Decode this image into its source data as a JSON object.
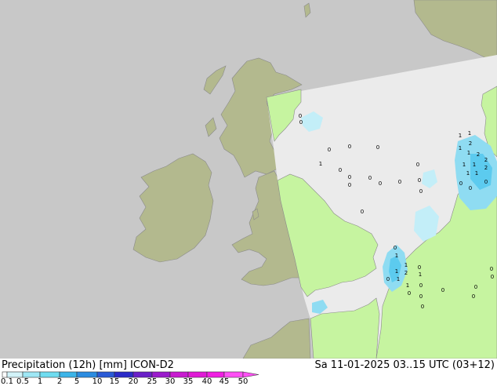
{
  "header": {
    "title": "Precipitation (12h) [mm] ICON-D2",
    "valid_time": "Sa 11-01-2025 03..15 UTC (03+12)"
  },
  "legend": {
    "ticks": [
      "0.1",
      "0.5",
      "1",
      "2",
      "5",
      "10",
      "15",
      "20",
      "25",
      "30",
      "35",
      "40",
      "45",
      "50"
    ],
    "colors": [
      "#ffffff",
      "#d2f3f9",
      "#9ee7f5",
      "#6fdcf0",
      "#3cb4e8",
      "#2b8ce0",
      "#2a5ad6",
      "#2b2bc8",
      "#6a1fc8",
      "#9a1acc",
      "#c81ad0",
      "#e01ad6",
      "#f01ee2",
      "#ff50f5"
    ]
  },
  "map": {
    "colors": {
      "outside": "#c8c8c8",
      "land_outside": "#b3b98e",
      "domain_sea": "#ebebeb",
      "domain_land": "#c6f4a0",
      "coast": "#8a8a8a",
      "precip_light": "#c3eef8",
      "precip_mid": "#8fdcf2",
      "precip_strong": "#5ccbef"
    },
    "labels": [
      {
        "text": "0"
      },
      {
        "text": "0"
      },
      {
        "text": "0"
      },
      {
        "text": "0"
      },
      {
        "text": "0"
      },
      {
        "text": "1"
      },
      {
        "text": "0"
      },
      {
        "text": "0"
      },
      {
        "text": "0"
      },
      {
        "text": "0"
      },
      {
        "text": "0"
      },
      {
        "text": "0"
      },
      {
        "text": "0"
      },
      {
        "text": "0"
      },
      {
        "text": "0"
      },
      {
        "text": "1"
      },
      {
        "text": "1"
      },
      {
        "text": "2"
      },
      {
        "text": "1"
      },
      {
        "text": "1"
      },
      {
        "text": "2"
      },
      {
        "text": "2"
      },
      {
        "text": "1"
      },
      {
        "text": "1"
      },
      {
        "text": "2"
      },
      {
        "text": "1"
      },
      {
        "text": "1"
      },
      {
        "text": "0"
      },
      {
        "text": "0"
      },
      {
        "text": "0"
      },
      {
        "text": "1"
      },
      {
        "text": "1"
      },
      {
        "text": "1"
      },
      {
        "text": "2"
      },
      {
        "text": "1"
      },
      {
        "text": "1"
      },
      {
        "text": "0"
      },
      {
        "text": "1"
      },
      {
        "text": "0"
      },
      {
        "text": "0"
      },
      {
        "text": "0"
      },
      {
        "text": "0"
      },
      {
        "text": "0"
      },
      {
        "text": "0"
      },
      {
        "text": "0"
      },
      {
        "text": "0"
      },
      {
        "text": "0"
      },
      {
        "text": "0"
      },
      {
        "text": "0"
      },
      {
        "text": "0"
      }
    ]
  }
}
